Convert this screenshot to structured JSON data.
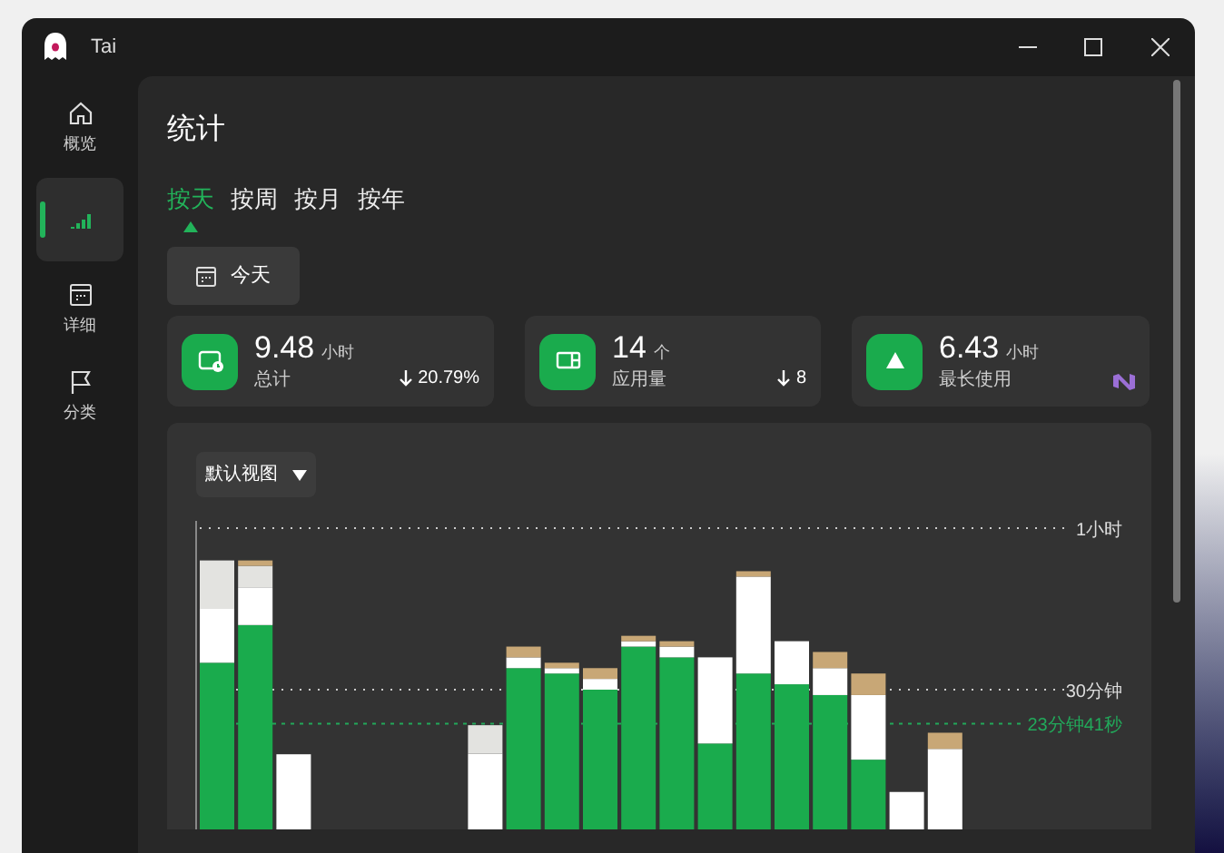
{
  "window": {
    "title": "Tai"
  },
  "sidebar": {
    "items": [
      {
        "label": "概览",
        "selected": false
      },
      {
        "selected": true
      },
      {
        "label": "详细",
        "selected": false
      },
      {
        "label": "分类",
        "selected": false
      }
    ]
  },
  "page": {
    "title": "统计"
  },
  "tabs": [
    {
      "label": "按天",
      "selected": true
    },
    {
      "label": "按周",
      "selected": false
    },
    {
      "label": "按月",
      "selected": false
    },
    {
      "label": "按年",
      "selected": false
    }
  ],
  "date_button": {
    "label": "今天"
  },
  "stats": [
    {
      "value": "9.48",
      "unit": "小时",
      "label": "总计",
      "change": "20.79%"
    },
    {
      "value": "14",
      "unit": "个",
      "label": "应用量",
      "change": "8"
    },
    {
      "value": "6.43",
      "unit": "小时",
      "label": "最长使用"
    }
  ],
  "chart_panel": {
    "view_dropdown": "默认视图",
    "gridline_labels": [
      "1小时",
      "30分钟"
    ],
    "average_label": "23分钟41秒"
  }
}
